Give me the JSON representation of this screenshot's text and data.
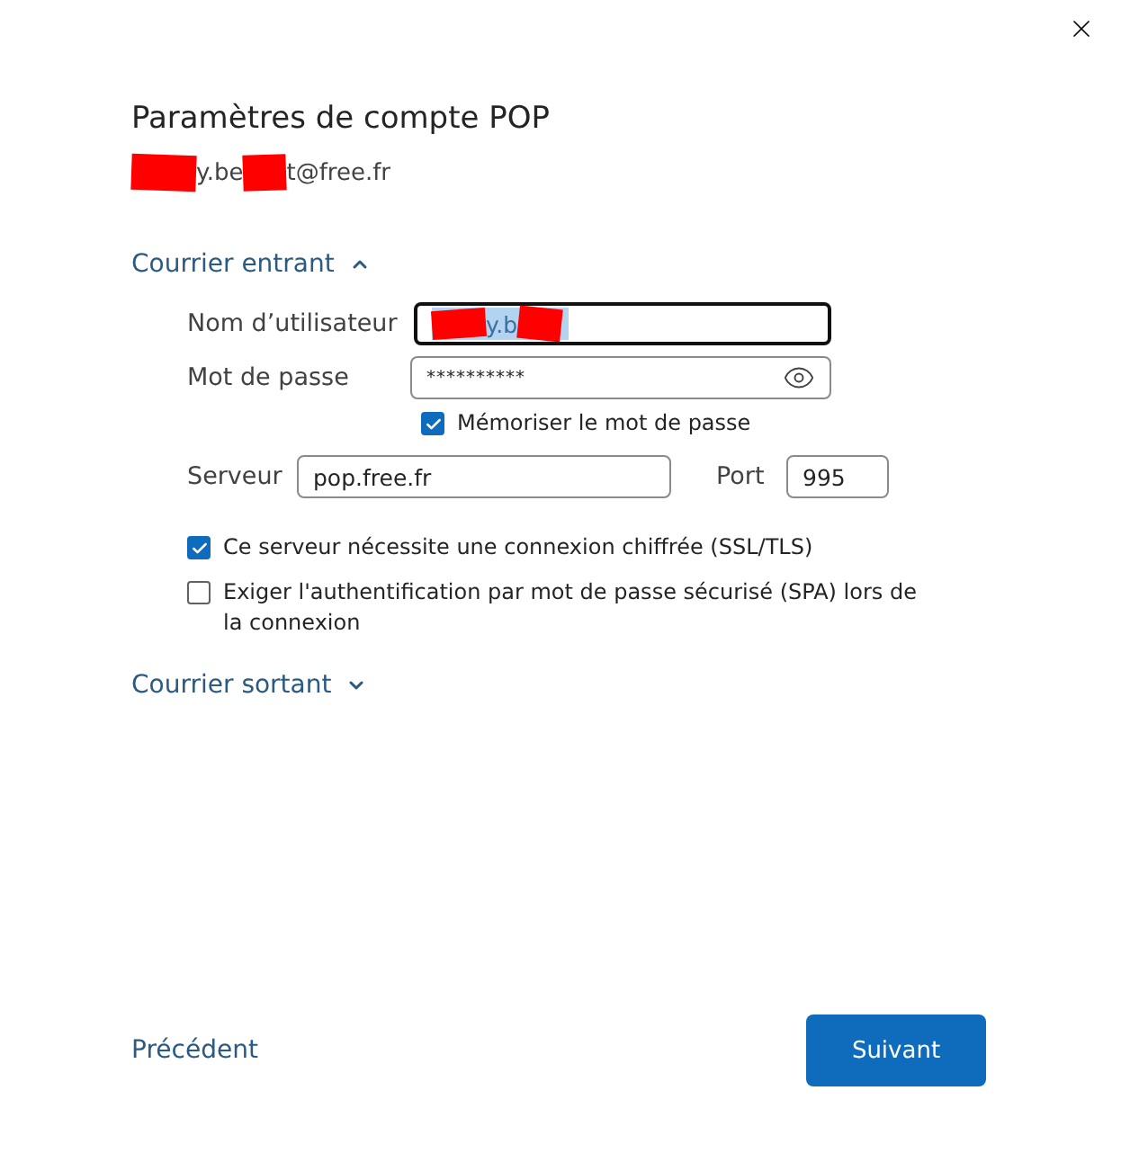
{
  "dialog": {
    "title": "Paramètres de compte POP",
    "account_parts": [
      "y.be",
      "t@free.fr"
    ]
  },
  "incoming": {
    "label": "Courrier entrant",
    "expanded": true,
    "username": {
      "label": "Nom d’utilisateur",
      "value": "y.b",
      "focused": true
    },
    "password": {
      "label": "Mot de passe",
      "value": "**********"
    },
    "remember": {
      "label": "Mémoriser le mot de passe",
      "checked": true
    },
    "server": {
      "label": "Serveur",
      "value": "pop.free.fr"
    },
    "port": {
      "label": "Port",
      "value": "995"
    },
    "options": [
      {
        "label": "Ce serveur nécessite une connexion chiffrée (SSL/TLS)",
        "checked": true
      },
      {
        "label": "Exiger l'authentification par mot de passe sécurisé (SPA) lors de la connexion",
        "checked": false
      }
    ]
  },
  "outgoing": {
    "label": "Courrier sortant",
    "expanded": false
  },
  "footer": {
    "back": "Précédent",
    "next": "Suivant"
  }
}
